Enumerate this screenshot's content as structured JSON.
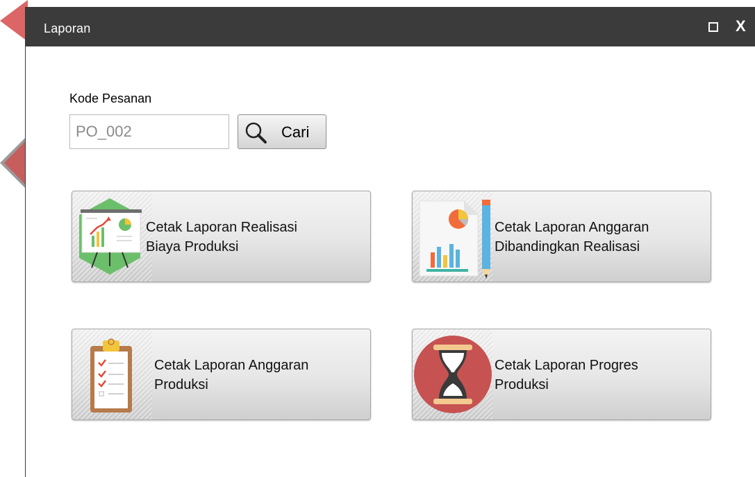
{
  "window": {
    "title": "Laporan"
  },
  "form": {
    "field_label": "Kode Pesanan",
    "field_value": "PO_002",
    "search_label": "Cari"
  },
  "reports": [
    {
      "label": "Cetak Laporan Realisasi\nBiaya Produksi",
      "icon": "presentation-chart-icon"
    },
    {
      "label": "Cetak Laporan Anggaran\nDibandingkan Realisasi",
      "icon": "document-chart-pencil-icon"
    },
    {
      "label": "Cetak Laporan Anggaran\nProduksi",
      "icon": "clipboard-checklist-icon"
    },
    {
      "label": "Cetak Laporan Progres\nProduksi",
      "icon": "hourglass-icon"
    }
  ],
  "colors": {
    "titlebar": "#3b3b3b",
    "green_hex": "#6cbf6a",
    "hourglass_circle": "#c75252",
    "hourglass_frame": "#f3c990",
    "clipboard": "#b77a4b",
    "pencil": "#5ab3e0",
    "pie_orange": "#f26b3a",
    "pie_yellow": "#f2c53a"
  }
}
